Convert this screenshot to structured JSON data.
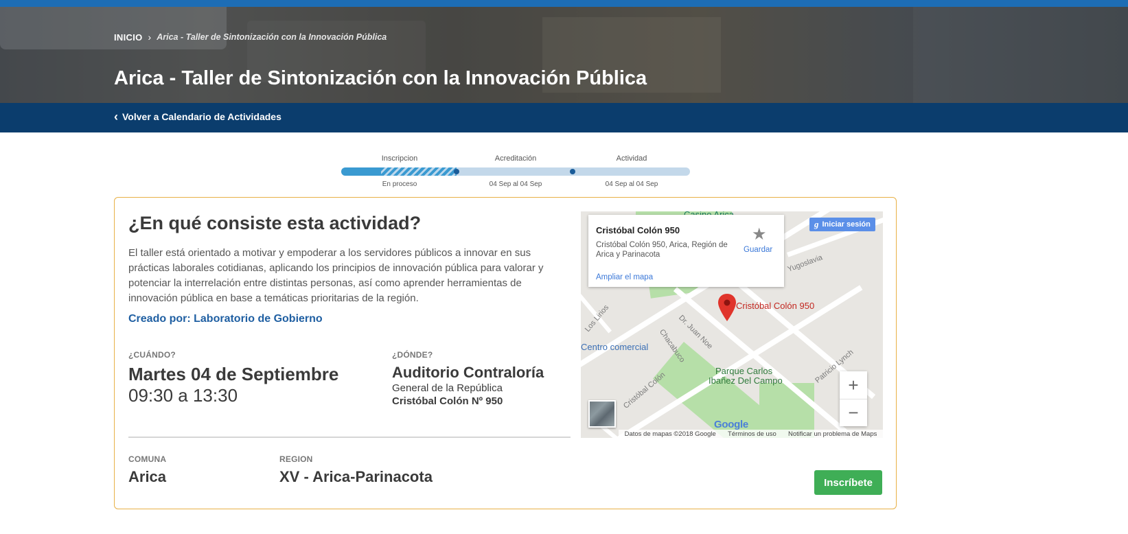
{
  "breadcrumb": {
    "home": "INICIO",
    "current": "Arica - Taller de Sintonización con la Innovación Pública"
  },
  "page_title": "Arica - Taller de Sintonización con la Innovación Pública",
  "subnav": {
    "back_label": "Volver a Calendario de Actividades"
  },
  "progress": {
    "steps": [
      {
        "label": "Inscripcion",
        "sub": "En proceso"
      },
      {
        "label": "Acreditación",
        "sub": "04 Sep al 04 Sep"
      },
      {
        "label": "Actividad",
        "sub": "04 Sep al 04 Sep"
      }
    ]
  },
  "activity": {
    "heading": "¿En qué consiste esta actividad?",
    "description": "El taller está orientado a motivar y empoderar a los servidores públicos a innovar en sus prácticas laborales cotidianas, aplicando los principios de innovación pública para valorar y potenciar la interrelación entre distintas personas, así como aprender herramientas de innovación pública en base a temáticas prioritarias de la región.",
    "created_by": "Creado por: Laboratorio de Gobierno",
    "when": {
      "label": "¿CUÁNDO?",
      "date": "Martes 04 de Septiembre",
      "time": "09:30 a 13:30"
    },
    "where": {
      "label": "¿DÓNDE?",
      "name": "Auditorio Contraloría",
      "line1": "General de la República",
      "line2": "Cristóbal Colón Nº 950"
    },
    "comuna": {
      "label": "COMUNA",
      "value": "Arica"
    },
    "region": {
      "label": "REGION",
      "value": "XV - Arica-Parinacota"
    },
    "cta_label": "Inscríbete"
  },
  "map": {
    "info_title": "Cristóbal Colón 950",
    "info_address": "Cristóbal Colón 950, Arica, Región de Arica y Parinacota",
    "info_link": "Ampliar el mapa",
    "save_label": "Guardar",
    "signin_label": "Iniciar sesión",
    "pin_label": "Cristóbal Colón 950",
    "places": {
      "casino": "Casino Arica",
      "yugoslavia": "Yugoslavia",
      "los_lirios": "Los Lirios",
      "centro_comercial": "Centro comercial",
      "dr_juan_noe": "Dr. Juan Noe",
      "chacabuco": "Chacabuco",
      "parque_line1": "Parque Carlos",
      "parque_line2": "Ibañez Del Campo",
      "patricio_lynch": "Patricio Lynch",
      "cristobal_colon": "Cristóbal Colón"
    },
    "logo": "Google",
    "footer": {
      "data": "Datos de mapas ©2018 Google",
      "terms": "Términos de uso",
      "report": "Notificar un problema de Maps"
    },
    "zoom_in": "+",
    "zoom_out": "−"
  },
  "colors": {
    "topbar": "#1d6db5",
    "subnav": "#0b3d6d",
    "card_border": "#e8b045",
    "link_blue": "#1f5fa2",
    "cta_green": "#3fae56",
    "progress_fill": "#3a9ad1"
  }
}
